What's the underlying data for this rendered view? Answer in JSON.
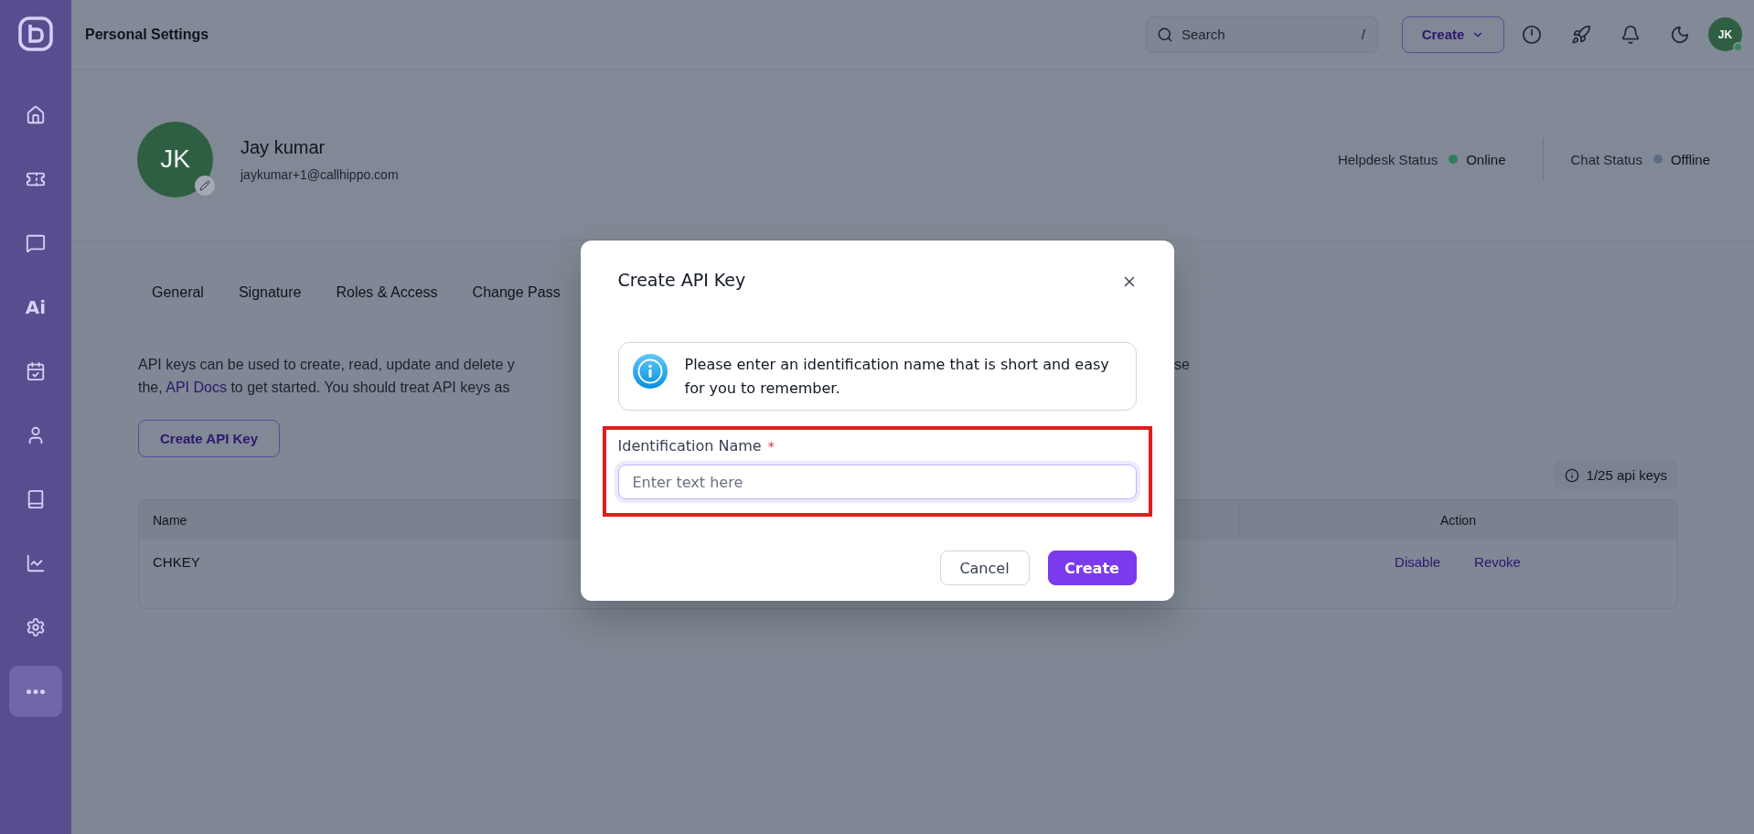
{
  "sidebar": {
    "items": [
      {
        "kind": "icon",
        "selected": false
      },
      {
        "kind": "icon",
        "selected": false
      },
      {
        "kind": "icon",
        "selected": false
      },
      {
        "kind": "text",
        "label": "Ai",
        "selected": false
      },
      {
        "kind": "icon",
        "selected": false
      },
      {
        "kind": "icon",
        "selected": false
      },
      {
        "kind": "icon",
        "selected": false
      },
      {
        "kind": "icon",
        "selected": false
      },
      {
        "kind": "icon",
        "selected": false
      },
      {
        "kind": "icon",
        "selected": true
      }
    ]
  },
  "header": {
    "title": "Personal Settings",
    "search": {
      "placeholder": "Search",
      "shortcut": "/"
    },
    "create_button": "Create",
    "avatar": {
      "initials": "JK",
      "online": true
    }
  },
  "profile": {
    "initials": "JK",
    "name": "Jay kumar",
    "email": "jaykumar+1@callhippo.com",
    "statuses": [
      {
        "label": "Helpdesk Status",
        "value": "Online",
        "color": "#2f7d5a"
      },
      {
        "label": "Chat Status",
        "value": "Offline",
        "color": "#5d6b86"
      }
    ]
  },
  "tabs": [
    {
      "label": "General",
      "selected": false
    },
    {
      "label": "Signature",
      "selected": false
    },
    {
      "label": "Roles & Access",
      "selected": false
    },
    {
      "label": "Change Pass",
      "selected": false
    }
  ],
  "api_keys": {
    "description": {
      "line_1": "API keys can be used to create, read, update and delete y",
      "line_1_end": "se",
      "line_2_start": "the,",
      "link": "API Docs",
      "line_2_end": "to get started. You should treat API keys as"
    },
    "create_button": "Create API Key",
    "usage_badge": "1/25 api keys",
    "table": {
      "columns": [
        {
          "label": "Name"
        },
        {
          "label": "Action"
        }
      ],
      "rows": [
        {
          "name": "CHKEY",
          "actions": [
            "Disable",
            "Revoke"
          ]
        }
      ]
    }
  },
  "modal": {
    "title": "Create API Key",
    "info": "Please enter an identification name that is short and easy for you to remember.",
    "field": {
      "label": "Identification Name",
      "required_mark": "*",
      "placeholder": "Enter text here",
      "focused": true,
      "highlighted": true
    },
    "buttons": [
      {
        "label": "Cancel",
        "kind": "secondary"
      },
      {
        "label": "Create",
        "kind": "primary"
      }
    ]
  }
}
